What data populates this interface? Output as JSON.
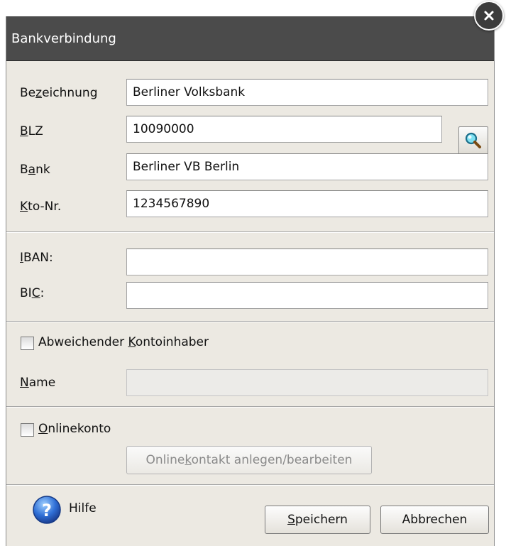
{
  "dialog": {
    "title": "Bankverbindung"
  },
  "bank": {
    "bezeichnung_label": "Bezeichnung",
    "bezeichnung_value": "Berliner Volksbank",
    "blz_label": "BLZ",
    "blz_value": "10090000",
    "bank_label": "Bank",
    "bank_value": "Berliner VB Berlin",
    "kto_label": "Kto-Nr.",
    "kto_value": "1234567890"
  },
  "sepa": {
    "iban_label": "IBAN:",
    "iban_value": "",
    "bic_label": "BIC:",
    "bic_value": ""
  },
  "holder": {
    "checkbox_label": "Abweichender Kontoinhaber",
    "checked": false,
    "name_label": "Name",
    "name_value": ""
  },
  "online": {
    "checkbox_label": "Onlinekonto",
    "checked": false,
    "button_label": "Onlinekontakt anlegen/bearbeiten"
  },
  "footer": {
    "help_label": "Hilfe",
    "save_label": "Speichern",
    "cancel_label": "Abbrechen"
  },
  "icons": {
    "close": "close-icon",
    "search": "magnifier-icon",
    "help": "help-icon"
  },
  "colors": {
    "titlebar": "#4b4b4b",
    "dialog_bg": "#ece9e2",
    "help_icon": "#2f6fd6"
  }
}
